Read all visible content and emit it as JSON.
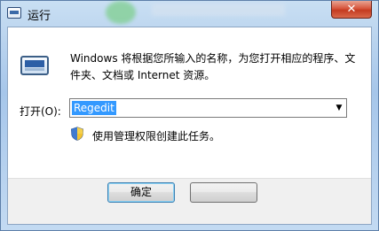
{
  "window": {
    "title": "运行",
    "close_glyph": "✕",
    "title_icon": "run-window-icon"
  },
  "dialog": {
    "icon": "run-program-icon",
    "description": "Windows 将根据您所输入的名称，为您打开相应的程序、文件夹、文档或 Internet 资源。",
    "open_label": "打开(O):",
    "open_value": "Regedit",
    "dropdown_glyph": "▼",
    "admin_icon": "uac-shield-icon",
    "admin_text": "使用管理权限创建此任务。"
  },
  "buttons": {
    "ok": "确定",
    "cancel": ""
  },
  "colors": {
    "selection": "#3399ff",
    "close_button": "#c43b21",
    "titlebar": "#b9d3ee"
  }
}
